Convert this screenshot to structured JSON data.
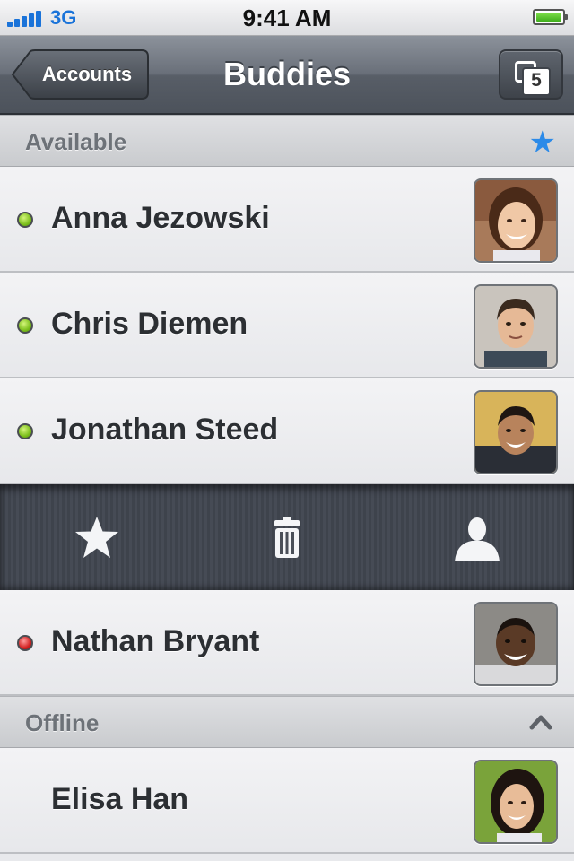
{
  "status_bar": {
    "carrier": "3G",
    "time": "9:41 AM",
    "battery_level": 1.0
  },
  "nav": {
    "back_label": "Accounts",
    "title": "Buddies",
    "tabs_count": "5"
  },
  "sections": {
    "available": {
      "title": "Available",
      "icon": "star-icon"
    },
    "offline": {
      "title": "Offline",
      "icon": "chevron-up-icon"
    }
  },
  "buddies": [
    {
      "name": "Anna Jezowski",
      "status": "online"
    },
    {
      "name": "Chris Diemen",
      "status": "online"
    },
    {
      "name": "Jonathan Steed",
      "status": "online"
    },
    {
      "name": "Nathan Bryant",
      "status": "busy"
    },
    {
      "name": "Elisa Han",
      "status": "offline"
    }
  ],
  "action_tray": {
    "actions": [
      "favorite-star-icon",
      "trash-icon",
      "profile-icon"
    ]
  },
  "colors": {
    "accent_blue": "#2b8ae8",
    "online_green": "#7cbf1c",
    "busy_red": "#d32222",
    "nav_dark": "#4c525b"
  }
}
